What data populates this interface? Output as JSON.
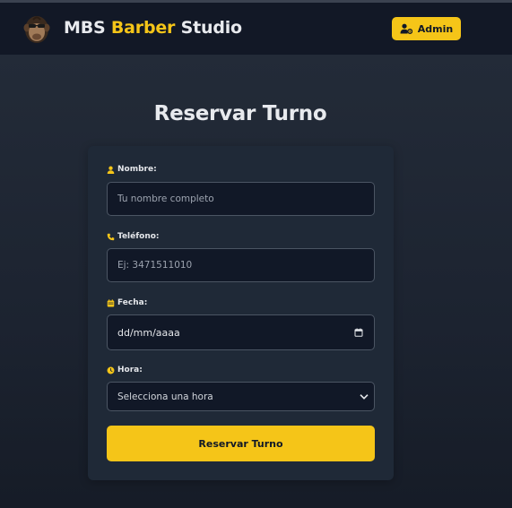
{
  "header": {
    "brand_part1": "MBS ",
    "brand_accent": "Barber",
    "brand_part2": " Studio",
    "admin_label": "Admin"
  },
  "page": {
    "title": "Reservar Turno"
  },
  "form": {
    "name": {
      "label": "Nombre:",
      "placeholder": "Tu nombre completo",
      "icon": "user-icon"
    },
    "phone": {
      "label": "Teléfono:",
      "placeholder": "Ej: 3471511010",
      "icon": "phone-icon"
    },
    "date": {
      "label": "Fecha:",
      "value": "dd/mm/aaaa",
      "icon": "calendar-icon"
    },
    "time": {
      "label": "Hora:",
      "selected": "Selecciona una hora",
      "icon": "clock-icon"
    },
    "submit_label": "Reservar Turno"
  },
  "colors": {
    "accent": "#f5c518",
    "navbar": "#121826",
    "card": "#1f2937",
    "input_bg": "#111827"
  }
}
